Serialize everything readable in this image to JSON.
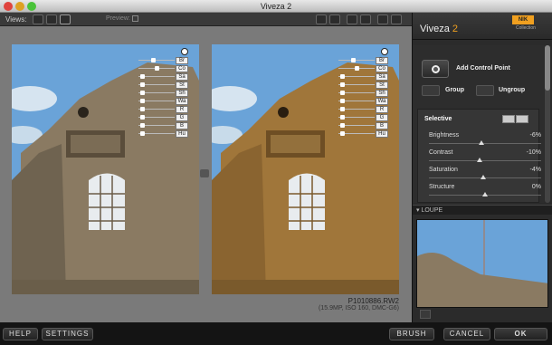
{
  "window": {
    "title": "Viveza 2"
  },
  "toolbar": {
    "views_label": "Views:",
    "preview_label": "Preview:"
  },
  "photo": {
    "filename": "P1010886.RW2",
    "info": "(15.9MP, ISO 160, DMC-G6)"
  },
  "control_point": {
    "labels": [
      "Br",
      "Co",
      "Sa",
      "St",
      "Sh",
      "Wa",
      "R",
      "G",
      "B",
      "Hu"
    ]
  },
  "sidebar": {
    "app_name": "Viveza",
    "app_version": "2",
    "brand": "NIK",
    "brand_sub": "Collection",
    "add_control_point": "Add Control Point",
    "group": "Group",
    "ungroup": "Ungroup",
    "selective_label": "Selective",
    "sliders": [
      {
        "name": "Brightness",
        "value": "-6%",
        "level": -6
      },
      {
        "name": "Contrast",
        "value": "-10%",
        "level": -10
      },
      {
        "name": "Saturation",
        "value": "-4%",
        "level": -4
      },
      {
        "name": "Structure",
        "value": "0%",
        "level": 0
      }
    ],
    "loupe_label": "LOUPE"
  },
  "bottom": {
    "help": "HELP",
    "settings": "SETTINGS",
    "brush": "BRUSH",
    "cancel": "CANCEL",
    "ok": "OK"
  },
  "colors": {
    "sky": "#6aa3d8",
    "stone_left": "#8a7a62",
    "stone_right": "#a0763a",
    "accent": "#f0a020"
  }
}
